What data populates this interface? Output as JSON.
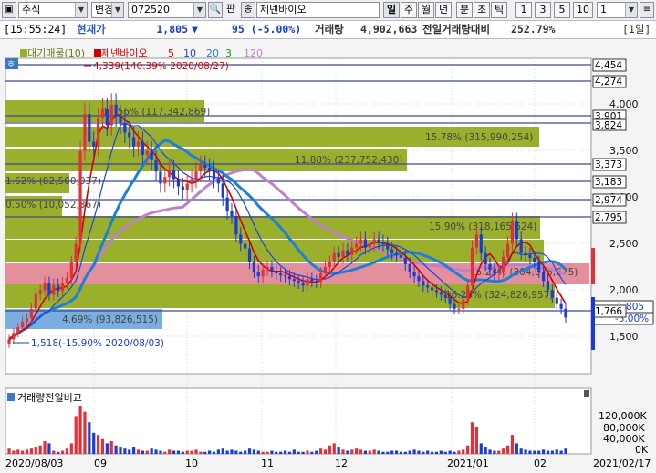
{
  "toolbar": {
    "market": "주식",
    "change_label": "변경",
    "code": "072520",
    "ticket_label": "판",
    "name": "제넨바이오",
    "periods": [
      "일",
      "주",
      "월",
      "년",
      "분",
      "초",
      "틱"
    ],
    "numbers": [
      "1",
      "3",
      "5",
      "10"
    ],
    "count": "1"
  },
  "info": {
    "time": "[15:55:24]",
    "current_label": "현재가",
    "price": "1,805",
    "change": "95 (-5.00%)",
    "volume_label": "거래량",
    "volume": "4,902,663",
    "prev_vol_label": "전일거래량대비",
    "prev_vol_ratio": "252.79%",
    "period_tag": "[1일]"
  },
  "legend": {
    "box_label": "호",
    "vp_label": "대기매물(10)",
    "name": "제넨바이오",
    "ma": [
      {
        "label": "5",
        "color": "#d40000"
      },
      {
        "label": "10",
        "color": "#1b46d9"
      },
      {
        "label": "20",
        "color": "#1e7fd6"
      },
      {
        "label": "3",
        "color": "#1c9a1c"
      },
      {
        "label": "120",
        "color": "#c080c8"
      }
    ]
  },
  "price_axis": [
    "4,000",
    "3,500",
    "3,000",
    "2,500",
    "2,000",
    "1,500"
  ],
  "level_boxes": [
    {
      "text": "4,454",
      "color": "#000"
    },
    {
      "text": "4,274",
      "color": "#000"
    },
    {
      "text": "3,901",
      "color": "#000"
    },
    {
      "text": "3,824",
      "color": "#000"
    },
    {
      "text": "3,373",
      "color": "#000"
    },
    {
      "text": "3,183",
      "color": "#000"
    },
    {
      "text": "2,974",
      "color": "#000"
    },
    {
      "text": "2,795",
      "color": "#000"
    },
    {
      "text": "1,805",
      "color": "#000"
    },
    {
      "text": "-5.00%",
      "color": "#000"
    },
    {
      "text": "1,766",
      "color": "#000"
    }
  ],
  "volume_profile": [
    {
      "label": "17.56% (117,342,869)",
      "pct": 17.56
    },
    {
      "label": "15.78% (315,990,254)",
      "pct": 15.78
    },
    {
      "label": "11.88% (237,752,430)",
      "pct": 11.88
    },
    {
      "label": "1.62% (82,560,037)",
      "pct": 1.62
    },
    {
      "label": "0.50% (10,052,367)",
      "pct": 0.5
    },
    {
      "label": "15.90% (318,165,624)",
      "pct": 15.9
    },
    {
      "label": "15.23% (304,075,675)",
      "pct": 15.23
    },
    {
      "label": "16.23% (324,826,957)",
      "pct": 16.23
    },
    {
      "label": "4.69% (93,826,515)",
      "pct": 4.69
    }
  ],
  "annotations": {
    "high": "4,339(140.39% 2020/08/27)",
    "low": "1,518(-15.90% 2020/08/03)"
  },
  "volume_panel": {
    "title": "거래량전일비교",
    "axis": [
      "120,000K",
      "80,000K",
      "40,000K",
      "0K"
    ]
  },
  "date_axis": [
    "2020/08/03",
    "09",
    "10",
    "11",
    "12",
    "2021/01",
    "02",
    "2021/02/17"
  ],
  "chart_data": {
    "type": "candlestick",
    "name": "제넨바이오",
    "x_start": "2020/08/03",
    "x_end": "2021/02/17",
    "y_range": [
      1200,
      4600
    ],
    "close": [
      1570,
      1640,
      1700,
      1760,
      1800,
      1900,
      2060,
      2100,
      2180,
      2050,
      2160,
      2090,
      2180,
      2230,
      2400,
      2600,
      3600,
      4000,
      3700,
      3650,
      3950,
      4050,
      3880,
      4100,
      3980,
      3900,
      3800,
      3750,
      3650,
      3700,
      3560,
      3600,
      3500,
      3380,
      3250,
      3320,
      3400,
      3300,
      3220,
      3180,
      3250,
      3300,
      3380,
      3450,
      3420,
      3390,
      3300,
      3250,
      3100,
      2950,
      2900,
      2700,
      2600,
      2550,
      2400,
      2300,
      2250,
      2320,
      2350,
      2310,
      2280,
      2260,
      2250,
      2220,
      2200,
      2180,
      2150,
      2220,
      2200,
      2190,
      2280,
      2350,
      2400,
      2500,
      2460,
      2530,
      2480,
      2560,
      2600,
      2650,
      2560,
      2600,
      2650,
      2620,
      2600,
      2540,
      2500,
      2480,
      2450,
      2380,
      2300,
      2250,
      2200,
      2150,
      2130,
      2100,
      2080,
      2050,
      2020,
      1950,
      1900,
      1900,
      2000,
      2150,
      2560,
      2700,
      2500,
      2380,
      2320,
      2280,
      2300,
      2460,
      2600,
      2850,
      2650,
      2500,
      2480,
      2450,
      2400,
      2300,
      2200,
      2100,
      2020,
      1950,
      1900,
      1805
    ],
    "volume_bars": [
      5,
      3,
      4,
      3,
      4,
      5,
      6,
      8,
      12,
      10,
      3,
      2,
      3,
      5,
      10,
      35,
      45,
      40,
      30,
      20,
      18,
      14,
      10,
      12,
      8,
      6,
      5,
      4,
      6,
      4,
      3,
      3,
      5,
      4,
      3,
      2,
      4,
      3,
      3,
      2,
      3,
      3,
      4,
      2,
      2,
      3,
      2,
      4,
      5,
      3,
      4,
      3,
      2,
      3,
      5,
      4,
      3,
      2,
      2,
      3,
      2,
      2,
      3,
      2,
      4,
      2,
      2,
      3,
      2,
      3,
      5,
      4,
      8,
      10,
      6,
      4,
      3,
      4,
      5,
      4,
      3,
      3,
      4,
      3,
      2,
      2,
      3,
      3,
      2,
      2,
      3,
      4,
      3,
      2,
      3,
      2,
      2,
      3,
      2,
      3,
      2,
      3,
      4,
      8,
      30,
      25,
      10,
      6,
      4,
      3,
      3,
      5,
      8,
      18,
      10,
      5,
      4,
      3,
      3,
      3,
      4,
      3,
      3,
      4,
      3,
      5
    ],
    "moving_averages": [
      "5",
      "10",
      "20",
      "3",
      "120"
    ]
  }
}
